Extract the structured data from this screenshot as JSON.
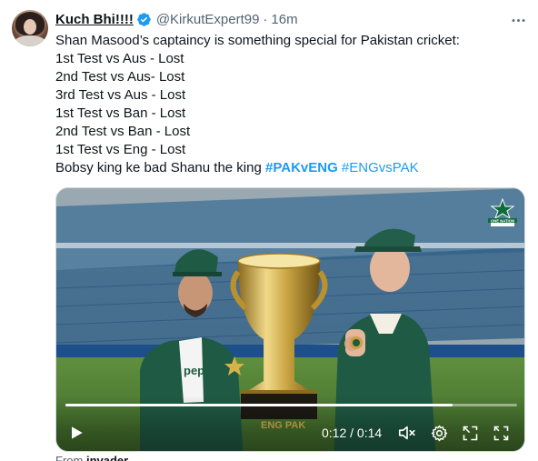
{
  "tweet": {
    "display_name": "Kuch Bhi!!!!",
    "handle": "@KirkutExpert99",
    "separator": "·",
    "time": "16m",
    "lines": [
      "Shan Masood’s captaincy is something special for Pakistan cricket:",
      "1st Test vs Aus - Lost",
      "2nd Test vs Aus- Lost",
      "3rd Test vs Aus - Lost",
      "1st Test vs Ban - Lost",
      "2nd Test vs Ban - Lost",
      "1st Test vs Eng - Lost"
    ],
    "last_line_text": "Bobsy king ke bad Shanu the king",
    "hashtags": [
      "#PAKvENG",
      "#ENGvsPAK"
    ]
  },
  "video": {
    "current_time": "0:12",
    "time_separator": " / ",
    "duration": "0:14",
    "progress_fraction": 0.857,
    "logo_text": "ONE NATION"
  },
  "from": {
    "prefix": "From",
    "source": "invader"
  },
  "icons": {
    "verified": "verified-badge-icon",
    "more": "more-options-icon",
    "play": "play-icon",
    "mute": "volume-muted-icon",
    "settings": "settings-gear-icon",
    "pip": "picture-in-picture-icon",
    "fullscreen": "fullscreen-icon"
  },
  "colors": {
    "accent": "#1d9bf0",
    "text": "#0f1419",
    "secondary": "#536471"
  }
}
